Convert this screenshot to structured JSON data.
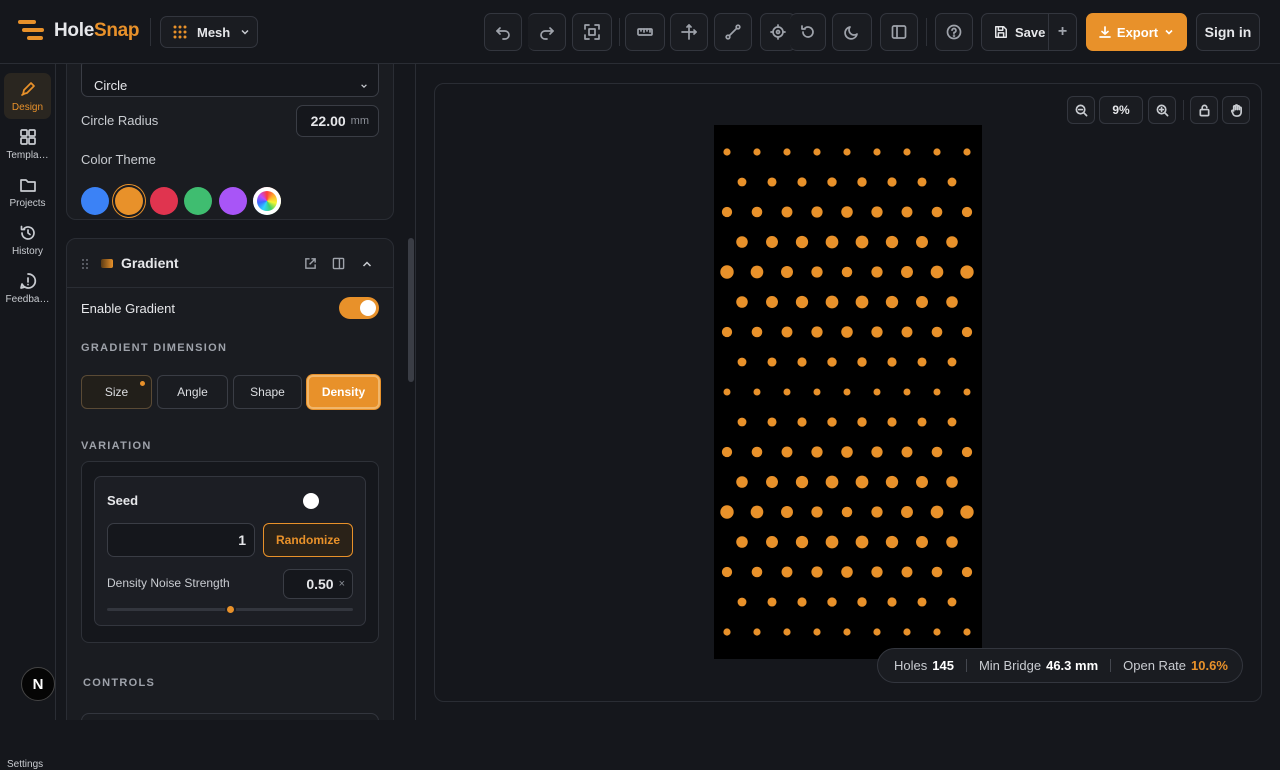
{
  "app": {
    "name_a": "Hole",
    "name_b": "Snap",
    "mode": "Mesh"
  },
  "toolbar": {
    "save_label": "Save",
    "export_label": "Export",
    "signin_label": "Sign in"
  },
  "rail": {
    "items": [
      "Design",
      "Templa…",
      "Projects",
      "History",
      "Feedba…"
    ],
    "settings": "Settings",
    "avatar": "N"
  },
  "shape": {
    "selected": "Circle",
    "radius_label": "Circle Radius",
    "radius_value": "22.00",
    "radius_unit": "mm",
    "color_theme_label": "Color Theme"
  },
  "theme_colors": [
    "#3b82f6",
    "#e8912a",
    "#e0344f",
    "#3fbd70",
    "#a855f7"
  ],
  "gradient": {
    "title": "Gradient",
    "enable_label": "Enable Gradient",
    "enabled": true,
    "dimension_label": "GRADIENT DIMENSION",
    "dimensions": [
      "Size",
      "Angle",
      "Shape",
      "Density"
    ],
    "active_dimension": "Density",
    "variation_label": "VARIATION",
    "seed_label": "Seed",
    "seed_value": "1",
    "randomize_label": "Randomize",
    "noise_label": "Density Noise Strength",
    "noise_value": "0.50",
    "noise_unit": "×",
    "noise_fraction": 0.5
  },
  "controls_label": "CONTROLS",
  "zoom": {
    "level": "9%"
  },
  "stats": {
    "holes_label": "Holes",
    "holes": "145",
    "bridge_label": "Min Bridge",
    "bridge": "46.3 mm",
    "open_label": "Open Rate",
    "open": "10.6%"
  },
  "accent": "#e8912a"
}
